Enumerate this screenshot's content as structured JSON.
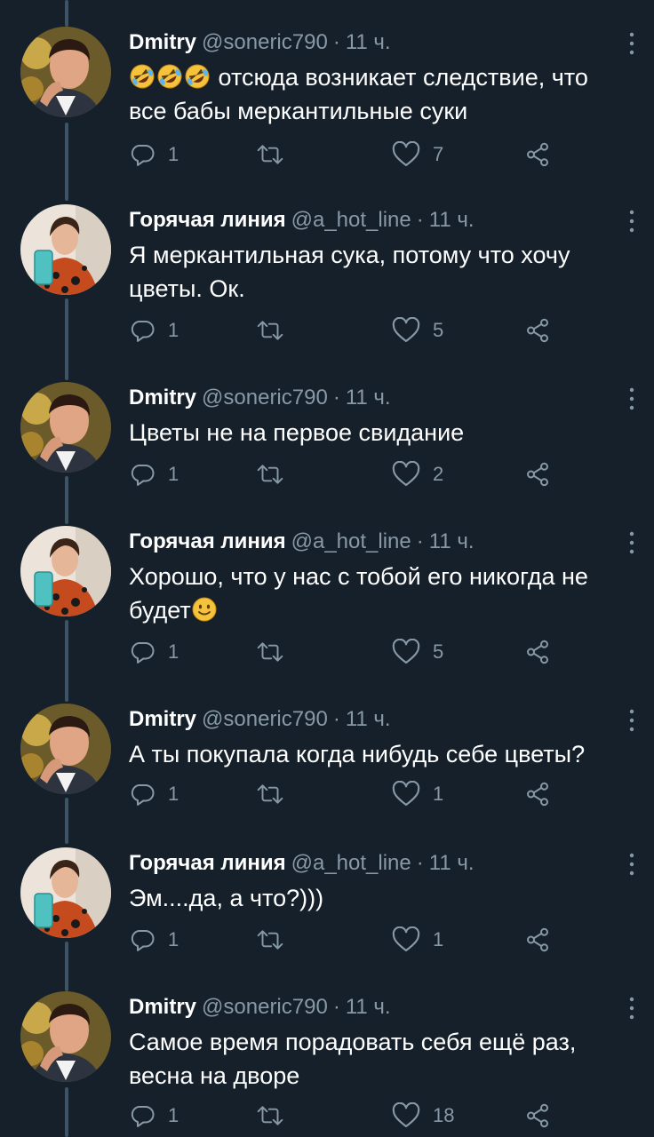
{
  "tweets": [
    {
      "name": "Dmitry",
      "handle": "@soneric790",
      "time": "11 ч.",
      "emoji": [
        "rolling-on-floor-laughing",
        "rolling-on-floor-laughing",
        "rolling-on-floor-laughing"
      ],
      "text": "отсюда возникает следствие, что все бабы меркантильные суки",
      "replies": "1",
      "retweets": "",
      "likes": "7"
    },
    {
      "name": "Горячая линия",
      "handle": "@a_hot_line",
      "time": "11 ч.",
      "text": "Я меркантильная сука, потому что хочу цветы. Ок.",
      "replies": "1",
      "retweets": "",
      "likes": "5"
    },
    {
      "name": "Dmitry",
      "handle": "@soneric790",
      "time": "11 ч.",
      "text": "Цветы не на первое свидание",
      "replies": "1",
      "retweets": "",
      "likes": "2"
    },
    {
      "name": "Горячая линия",
      "handle": "@a_hot_line",
      "time": "11 ч.",
      "text": "Хорошо, что у нас с тобой его никогда не будет",
      "emoji_after": "slightly-smiling-face",
      "replies": "1",
      "retweets": "",
      "likes": "5"
    },
    {
      "name": "Dmitry",
      "handle": "@soneric790",
      "time": "11 ч.",
      "text": "А ты покупала когда нибудь себе цветы?",
      "replies": "1",
      "retweets": "",
      "likes": "1"
    },
    {
      "name": "Горячая линия",
      "handle": "@a_hot_line",
      "time": "11 ч.",
      "text": "Эм....да, а что?)))",
      "replies": "1",
      "retweets": "",
      "likes": "1"
    },
    {
      "name": "Dmitry",
      "handle": "@soneric790",
      "time": "11 ч.",
      "text": "Самое время порадовать себя ещё раз, весна на дворе",
      "replies": "1",
      "retweets": "",
      "likes": "18"
    }
  ],
  "colors": {
    "background": "#15202b",
    "text": "#ffffff",
    "secondary": "#8899a6",
    "thread_line": "#3d5466"
  }
}
